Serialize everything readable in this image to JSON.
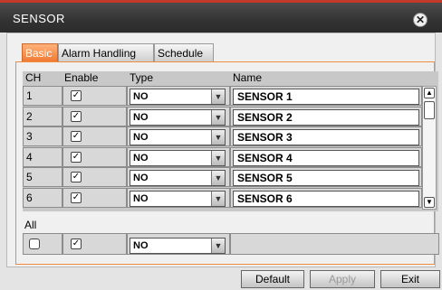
{
  "window": {
    "title": "SENSOR",
    "close_glyph": "✕"
  },
  "tabs": [
    "Basic",
    "Alarm Handling",
    "Schedule"
  ],
  "columns": [
    "CH",
    "Enable",
    "Type",
    "Name"
  ],
  "rows": [
    {
      "ch": "1",
      "enabled": true,
      "type": "NO",
      "name": "SENSOR 1"
    },
    {
      "ch": "2",
      "enabled": true,
      "type": "NO",
      "name": "SENSOR 2"
    },
    {
      "ch": "3",
      "enabled": true,
      "type": "NO",
      "name": "SENSOR 3"
    },
    {
      "ch": "4",
      "enabled": true,
      "type": "NO",
      "name": "SENSOR 4"
    },
    {
      "ch": "5",
      "enabled": true,
      "type": "NO",
      "name": "SENSOR 5"
    },
    {
      "ch": "6",
      "enabled": true,
      "type": "NO",
      "name": "SENSOR 6"
    }
  ],
  "all": {
    "label": "All",
    "select_all": false,
    "enabled": true,
    "type": "NO"
  },
  "buttons": {
    "default": "Default",
    "apply": "Apply",
    "exit": "Exit"
  },
  "colors": {
    "accent": "#f07a33",
    "titlebar": "#333333"
  }
}
